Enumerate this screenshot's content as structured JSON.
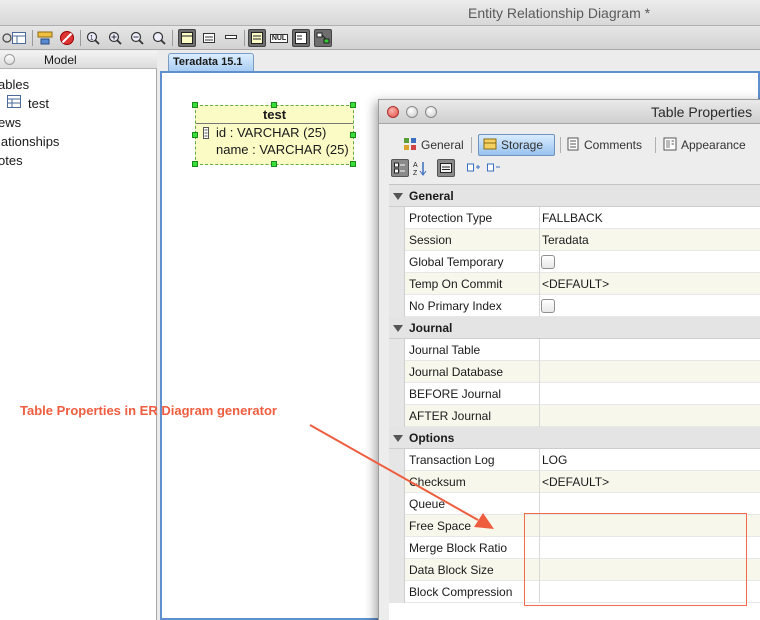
{
  "window": {
    "title": "Entity Relationship Diagram *"
  },
  "toolbar": {
    "icons": [
      "expand-icon",
      "layout-icon",
      "filter-icon",
      "no-entry-icon",
      "zoom-fit-icon",
      "zoom-in-icon",
      "zoom-out-icon",
      "zoom-reset-icon",
      "show-table-icon",
      "show-columns-icon",
      "show-keys-icon",
      "show-notes-icon",
      "show-null-icon",
      "show-types-icon",
      "show-relations-icon"
    ],
    "null_label": "NUL"
  },
  "left_panel": {
    "header": "Model",
    "tree": [
      {
        "label": "ables",
        "indent": 0
      },
      {
        "label": "test",
        "indent": 1
      },
      {
        "label": "ews",
        "indent": 0
      },
      {
        "label": "lationships",
        "indent": 0
      },
      {
        "label": "otes",
        "indent": 0
      }
    ]
  },
  "diagram": {
    "tab": "Teradata 15.1",
    "entity": {
      "name": "test",
      "columns": [
        "id : VARCHAR (25)",
        "name : VARCHAR (25)"
      ]
    }
  },
  "annotation": {
    "text": "Table Properties in ER Diagram generator",
    "color": "#ef5d3f"
  },
  "dialog": {
    "title": "Table Properties",
    "tabs": [
      {
        "label": "General",
        "active": false
      },
      {
        "label": "Storage",
        "active": true
      },
      {
        "label": "Comments",
        "active": false
      },
      {
        "label": "Appearance",
        "active": false
      }
    ],
    "properties": [
      {
        "type": "category",
        "name": "General"
      },
      {
        "type": "prop",
        "name": "Protection Type",
        "value": "FALLBACK"
      },
      {
        "type": "prop",
        "name": "Session",
        "value": "Teradata"
      },
      {
        "type": "check",
        "name": "Global Temporary",
        "checked": false
      },
      {
        "type": "prop",
        "name": "Temp On Commit",
        "value": "<DEFAULT>"
      },
      {
        "type": "check",
        "name": "No Primary Index",
        "checked": false
      },
      {
        "type": "category",
        "name": "Journal"
      },
      {
        "type": "prop",
        "name": "Journal Table",
        "value": ""
      },
      {
        "type": "prop",
        "name": "Journal Database",
        "value": ""
      },
      {
        "type": "prop",
        "name": "BEFORE Journal",
        "value": ""
      },
      {
        "type": "prop",
        "name": "AFTER Journal",
        "value": ""
      },
      {
        "type": "category",
        "name": "Options"
      },
      {
        "type": "prop",
        "name": "Transaction Log",
        "value": "LOG"
      },
      {
        "type": "prop",
        "name": "Checksum",
        "value": "<DEFAULT>"
      },
      {
        "type": "prop",
        "name": "Queue",
        "value": ""
      },
      {
        "type": "prop",
        "name": "Free Space",
        "value": ""
      },
      {
        "type": "prop",
        "name": "Merge Block Ratio",
        "value": ""
      },
      {
        "type": "prop",
        "name": "Data Block Size",
        "value": ""
      },
      {
        "type": "prop",
        "name": "Block Compression",
        "value": ""
      }
    ]
  }
}
